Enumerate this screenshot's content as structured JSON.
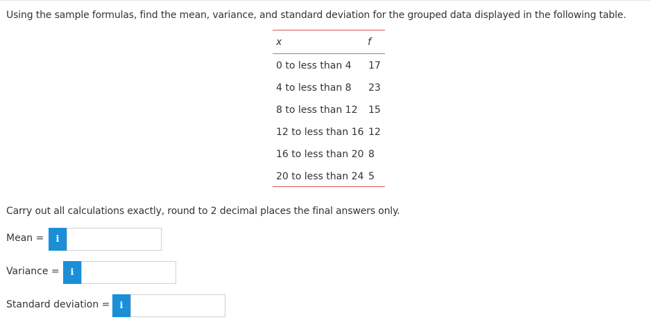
{
  "question": {
    "text": "Using the sample formulas, find the mean, variance, and standard deviation for the grouped data displayed in the following table."
  },
  "table": {
    "headers": {
      "x": "x",
      "f": "f"
    },
    "rows": [
      {
        "x": "0 to less than 4",
        "f": "17"
      },
      {
        "x": "4 to less than 8",
        "f": "23"
      },
      {
        "x": "8 to less than 12",
        "f": "15"
      },
      {
        "x": "12 to less than 16",
        "f": "12"
      },
      {
        "x": "16 to less than 20",
        "f": "8"
      },
      {
        "x": "20 to less than 24",
        "f": "5"
      }
    ]
  },
  "instruction": {
    "text": "Carry out all calculations exactly, round to 2 decimal places the final answers only."
  },
  "answers": {
    "mean": {
      "label": "Mean =",
      "value": "",
      "info_icon": "i"
    },
    "variance": {
      "label": "Variance =",
      "value": "",
      "info_icon": "i"
    },
    "std_dev": {
      "label": "Standard deviation =",
      "value": "",
      "info_icon": "i"
    }
  },
  "colors": {
    "info_button": "#1a8fd8",
    "table_rule": "#d9534f",
    "text": "#333333"
  }
}
